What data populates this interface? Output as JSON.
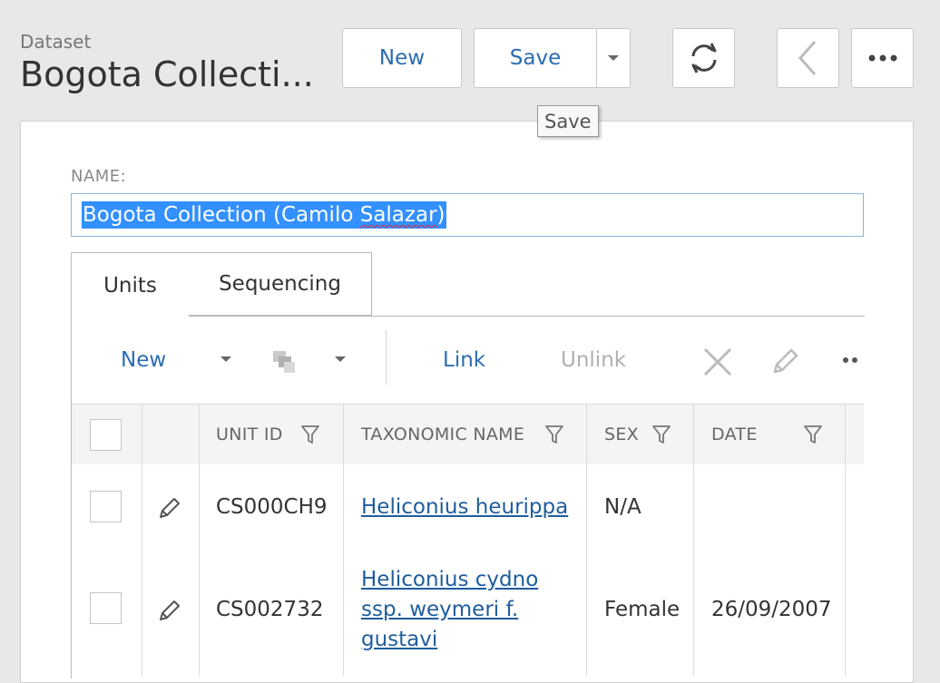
{
  "header": {
    "kind": "Dataset",
    "title": "Bogota Collecti..."
  },
  "toolbar": {
    "new_label": "New",
    "save_label": "Save",
    "tooltip": "Save"
  },
  "form": {
    "name_label": "NAME:",
    "name_value_before": "Bogota Collection (Camilo ",
    "name_value_spell": "Salazar",
    "name_value_after": ")"
  },
  "tabs": [
    {
      "label": "Units",
      "active": true
    },
    {
      "label": "Sequencing",
      "active": false
    }
  ],
  "grid_toolbar": {
    "new_label": "New",
    "link_label": "Link",
    "unlink_label": "Unlink"
  },
  "columns": [
    "UNIT ID",
    "TAXONOMIC NAME",
    "SEX",
    "DATE"
  ],
  "rows": [
    {
      "unit_id": "CS000CH9",
      "taxon_lines": [
        "Heliconius heurippa"
      ],
      "sex": "N/A",
      "date": ""
    },
    {
      "unit_id": "CS002732",
      "taxon_lines": [
        "Heliconius cydno",
        "ssp. weymeri f.",
        "gustavi"
      ],
      "sex": "Female",
      "date": "26/09/2007"
    }
  ],
  "colors": {
    "accent": "#2b6cb0",
    "selection": "#3390ff",
    "link": "#1f5d9c"
  }
}
